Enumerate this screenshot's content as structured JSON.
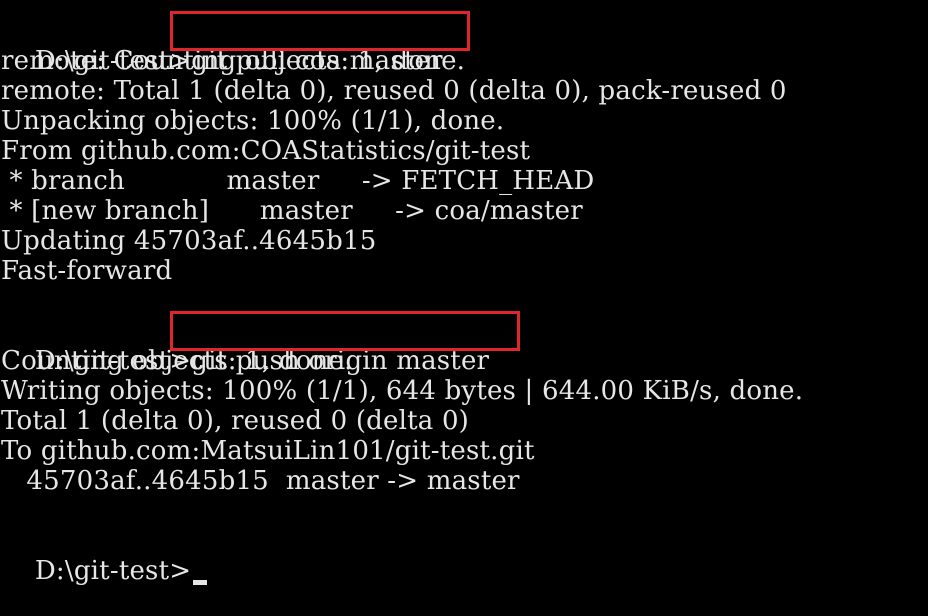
{
  "prompt": "D:\\git-test>",
  "commands": {
    "pull": "git pull coa master",
    "push": "git push origin master"
  },
  "pull_output": [
    "remote: Counting objects: 1, done.",
    "remote: Total 1 (delta 0), reused 0 (delta 0), pack-reused 0",
    "Unpacking objects: 100% (1/1), done.",
    "From github.com:COAStatistics/git-test",
    " * branch            master     -> FETCH_HEAD",
    " * [new branch]      master     -> coa/master",
    "Updating 45703af..4645b15",
    "Fast-forward"
  ],
  "push_output": [
    "Counting objects: 1, done.",
    "Writing objects: 100% (1/1), 644 bytes | 644.00 KiB/s, done.",
    "Total 1 (delta 0), reused 0 (delta 0)",
    "To github.com:MatsuiLin101/git-test.git",
    "   45703af..4645b15  master -> master"
  ],
  "highlight_color": "#e0262a",
  "text_color": "#e6e6e6",
  "background_color": "#000000"
}
